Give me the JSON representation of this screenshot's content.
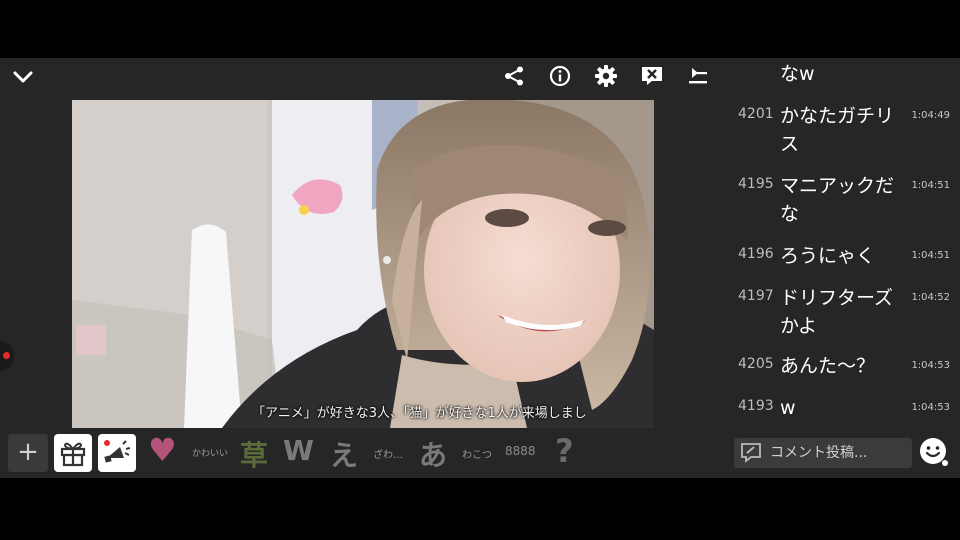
{
  "toolbar": {
    "collapse_icon": "chevron-down-icon",
    "icons": [
      "share-icon",
      "info-icon",
      "gear-icon",
      "comment-off-icon",
      "quality-icon"
    ]
  },
  "video": {
    "subtitle": "「アニメ」が好きな3人、「猫」が好きな1人が来場しまし"
  },
  "chat": {
    "top_partial": "なw",
    "messages": [
      {
        "num": "4201",
        "text": "かなたガチリス",
        "time": "1:04:49"
      },
      {
        "num": "4195",
        "text": "マニアックだな",
        "time": "1:04:51"
      },
      {
        "num": "4196",
        "text": "ろうにゃく",
        "time": "1:04:51"
      },
      {
        "num": "4197",
        "text": "ドリフターズかよ",
        "time": "1:04:52"
      },
      {
        "num": "4205",
        "text": "あんた～？",
        "time": "1:04:53"
      },
      {
        "num": "4193",
        "text": "w",
        "time": "1:04:53"
      }
    ]
  },
  "bottom": {
    "plus_label": "+",
    "gift_icon": "gift-icon",
    "announce_icon": "megaphone-icon",
    "stamps": {
      "heart": "♥",
      "kawaii": "かわいい",
      "kusa": "草",
      "w": "W",
      "e": "え",
      "zawa": "ざわ…",
      "a": "あ",
      "wakou": "わこつ",
      "clap": "8888",
      "question": "?"
    },
    "comment_placeholder": "コメント投稿...",
    "emoji_icon": "smiley-icon"
  },
  "colors": {
    "app_bg": "#262626",
    "heart": "#b5547a",
    "kusa": "#5c6b3a",
    "live_dot": "#e52b2b"
  }
}
